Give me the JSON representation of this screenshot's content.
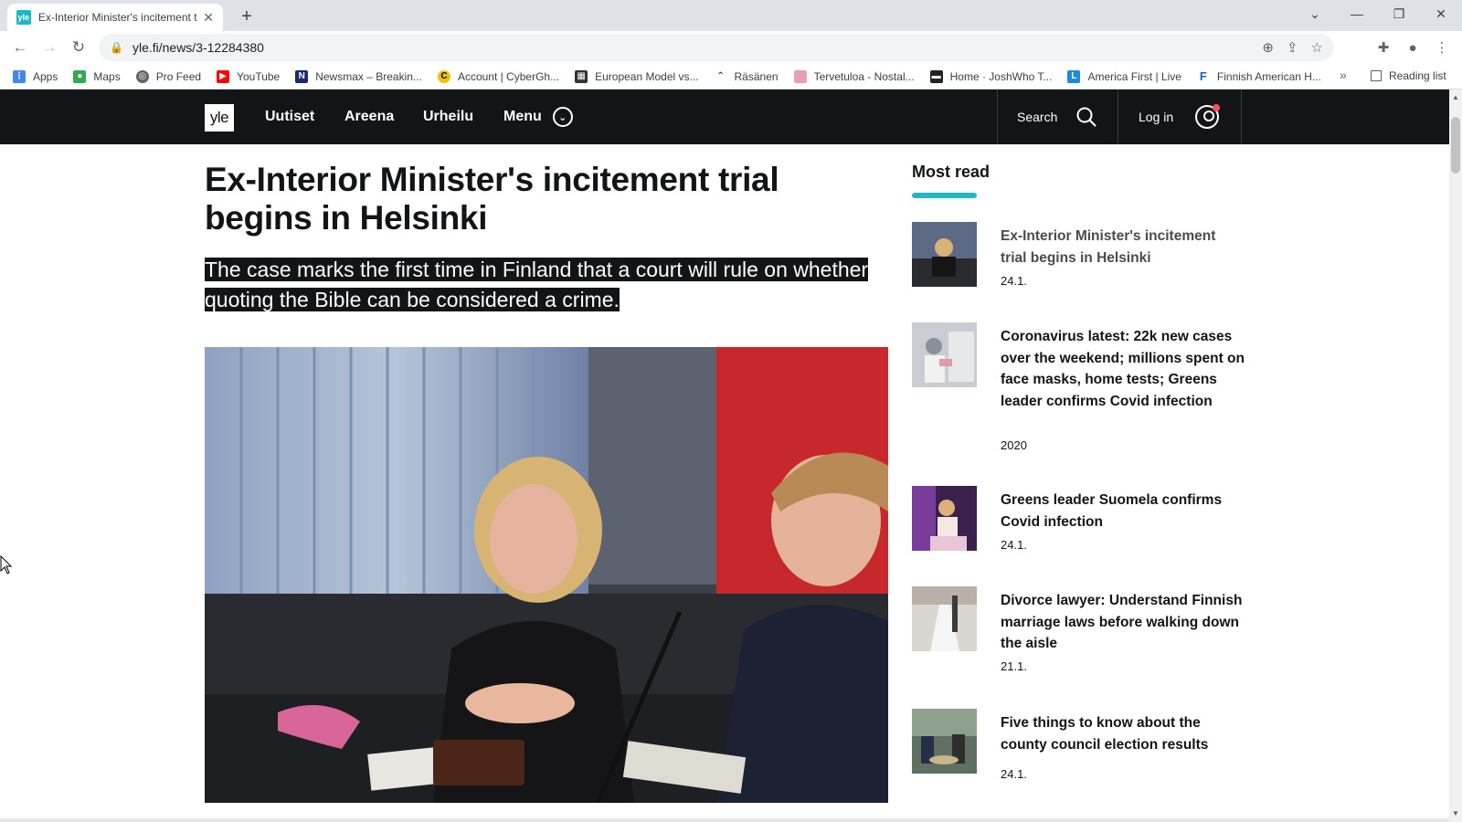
{
  "browser": {
    "tab_title": "Ex-Interior Minister's incitement t",
    "favicon_text": "yle",
    "url": "yle.fi/news/3-12284380",
    "bookmarks": [
      {
        "label": "Apps",
        "color": "#4285f4"
      },
      {
        "label": "Maps",
        "color": "#34a853"
      },
      {
        "label": "Pro Feed",
        "color": "#5f6368"
      },
      {
        "label": "YouTube",
        "color": "#ff0000"
      },
      {
        "label": "Newsmax – Breakin...",
        "color": "#1a2b6d"
      },
      {
        "label": "Account | CyberGh...",
        "color": "#f2c200"
      },
      {
        "label": "European Model vs...",
        "color": "#333333"
      },
      {
        "label": "Räsänen",
        "color": "#333333"
      },
      {
        "label": "Tervetuloa - Nostal...",
        "color": "#e8a0b0"
      },
      {
        "label": "Home · JoshWho T...",
        "color": "#222222"
      },
      {
        "label": "America First | Live",
        "color": "#1e88e5"
      },
      {
        "label": "Finnish American H...",
        "color": "#1565c0"
      }
    ],
    "reading_list": "Reading list"
  },
  "site": {
    "logo": "yle",
    "nav": [
      "Uutiset",
      "Areena",
      "Urheilu"
    ],
    "menu_label": "Menu",
    "search_label": "Search",
    "login_label": "Log in"
  },
  "article": {
    "headline": "Ex-Interior Minister's incitement trial begins in Helsinki",
    "lead": "The case marks the first time in Finland that a court will rule on whether quoting the Bible can be considered a crime."
  },
  "most_read": {
    "title": "Most read",
    "accent_color": "#21b9c1",
    "items": [
      {
        "title": "Ex-Interior Minister's incitement trial begins in Helsinki",
        "date": "24.1."
      },
      {
        "title": "Coronavirus latest: 22k new cases over the weekend; millions spent on face masks, home tests; Greens leader confirms Covid infection",
        "date": "2020"
      },
      {
        "title": "Greens leader Suomela confirms Covid infection",
        "date": "24.1."
      },
      {
        "title": "Divorce lawyer: Understand Finnish marriage laws before walking down the aisle",
        "date": "21.1."
      },
      {
        "title": "Five things to know about the county council election results",
        "date": "24.1."
      }
    ]
  }
}
